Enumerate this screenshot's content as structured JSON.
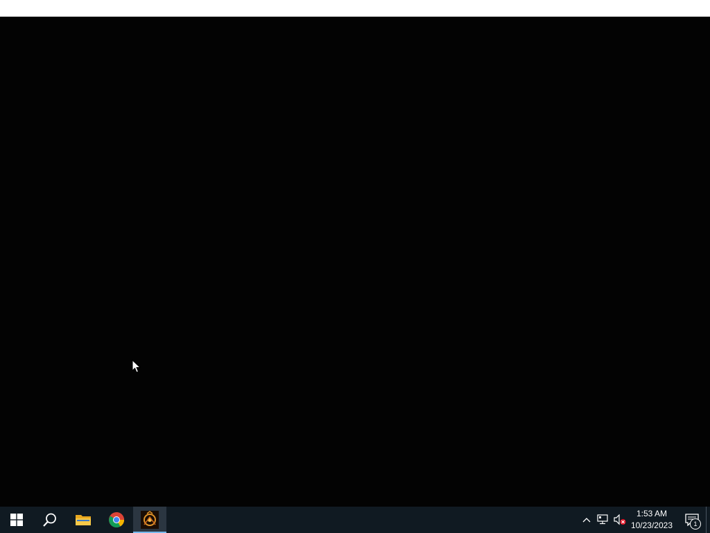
{
  "desktop": {
    "background_color": "#000000"
  },
  "taskbar": {
    "apps": [
      {
        "name": "start",
        "icon": "windows-logo-icon"
      },
      {
        "name": "search",
        "icon": "search-icon"
      },
      {
        "name": "file-explorer",
        "icon": "folder-icon"
      },
      {
        "name": "chrome",
        "icon": "chrome-icon"
      },
      {
        "name": "game",
        "icon": "game-app-icon",
        "active": true
      }
    ],
    "tray": {
      "icons": [
        "chevron-up-icon",
        "network-icon",
        "volume-muted-icon"
      ],
      "time": "1:53 AM",
      "date": "10/23/2023",
      "notification_count": "1"
    }
  },
  "colors": {
    "taskbar_bg": "#101a22",
    "active_indicator": "#76b9ed"
  }
}
